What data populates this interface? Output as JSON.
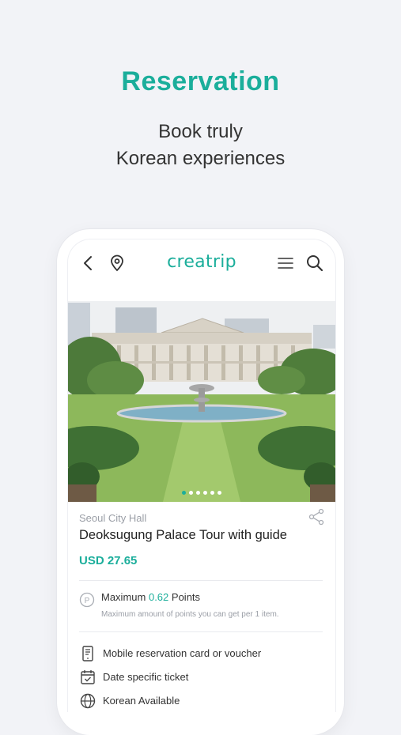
{
  "promo": {
    "headline": "Reservation",
    "subline_1": "Book truly",
    "subline_2": "Korean experiences"
  },
  "app": {
    "logo": "creatrip",
    "icons": [
      "back-arrow-icon",
      "location-pin-icon",
      "menu-icon",
      "search-icon"
    ]
  },
  "carousel": {
    "total": 6,
    "active_index": 0
  },
  "product": {
    "location": "Seoul City Hall",
    "title": "Deoksugung Palace Tour with guide",
    "price": "USD 27.65"
  },
  "points": {
    "prefix": "Maximum",
    "value": "0.62",
    "suffix": "Points",
    "note": "Maximum amount of points you can get per 1 item."
  },
  "features": [
    {
      "icon": "mobile-ticket-icon",
      "label": "Mobile reservation card or voucher"
    },
    {
      "icon": "calendar-check-icon",
      "label": "Date specific ticket"
    },
    {
      "icon": "globe-icon",
      "label": "Korean Available"
    }
  ],
  "colors": {
    "accent": "#1bae9b",
    "background": "#f2f3f7"
  }
}
